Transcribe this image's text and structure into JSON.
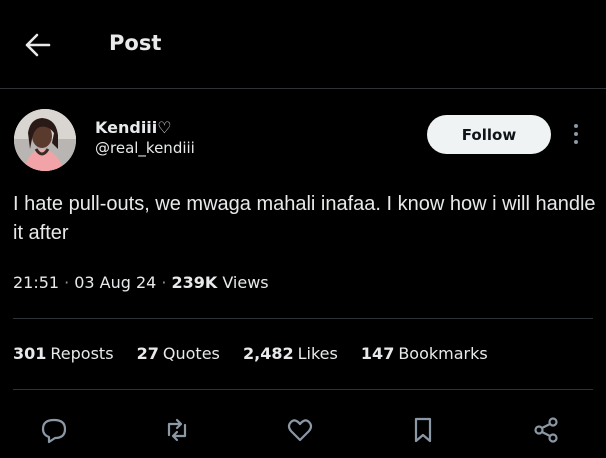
{
  "header": {
    "title": "Post",
    "back_icon": "arrow-left-icon"
  },
  "author": {
    "display_name": "Kendiii♡",
    "handle": "@real_kendiii",
    "avatar": "avatar-photo"
  },
  "actions_top": {
    "follow_label": "Follow",
    "more_icon": "more-vertical-icon"
  },
  "tweet": {
    "text": "I hate pull-outs, we mwaga mahali inafaa. I know how i will handle it after"
  },
  "meta": {
    "time": "21:51",
    "date": "03 Aug 24",
    "views_count": "239K",
    "views_label": "Views"
  },
  "stats": [
    {
      "count": "301",
      "label": "Reposts"
    },
    {
      "count": "27",
      "label": "Quotes"
    },
    {
      "count": "2,482",
      "label": "Likes"
    },
    {
      "count": "147",
      "label": "Bookmarks"
    }
  ],
  "action_bar": [
    "reply-icon",
    "repost-icon",
    "like-icon",
    "bookmark-icon",
    "share-icon"
  ],
  "colors": {
    "background": "#000000",
    "text": "#e7e9ea",
    "divider": "#2f3336",
    "follow_bg": "#eff3f4"
  }
}
